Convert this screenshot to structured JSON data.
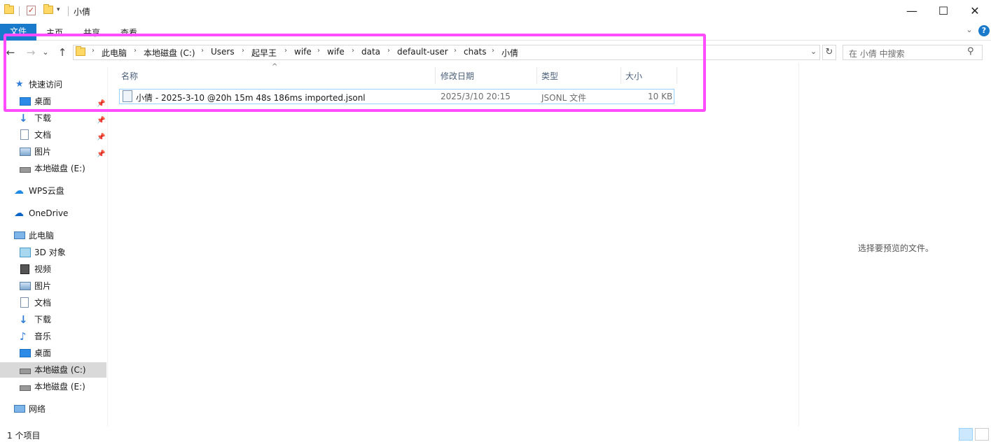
{
  "window": {
    "title": "小倩",
    "minimize": "—",
    "maximize": "☐",
    "close": "✕"
  },
  "ribbon": {
    "tabs": [
      "文件",
      "主页",
      "共享",
      "查看"
    ],
    "expand_icon": "chevron-down-icon",
    "help": "?"
  },
  "nav": {
    "back": "←",
    "forward": "→",
    "recent": "⌄",
    "up": "↑",
    "breadcrumb": [
      "此电脑",
      "本地磁盘 (C:)",
      "Users",
      "起早王",
      "wife",
      "wife",
      "data",
      "default-user",
      "chats",
      "小倩"
    ],
    "refresh": "↻",
    "search_placeholder": "在 小倩 中搜索"
  },
  "sidebar": {
    "quick_access": "快速访问",
    "quick_items": [
      "桌面",
      "下载",
      "文档",
      "图片",
      "本地磁盘 (E:)"
    ],
    "wps": "WPS云盘",
    "onedrive": "OneDrive",
    "this_pc": "此电脑",
    "pc_items": [
      "3D 对象",
      "视频",
      "图片",
      "文档",
      "下载",
      "音乐",
      "桌面",
      "本地磁盘 (C:)",
      "本地磁盘 (E:)"
    ],
    "network": "网络"
  },
  "columns": {
    "name": "名称",
    "modified": "修改日期",
    "type": "类型",
    "size": "大小"
  },
  "files": [
    {
      "name": "小倩 - 2025-3-10 @20h 15m 48s 186ms imported.jsonl",
      "modified": "2025/3/10 20:15",
      "type": "JSONL 文件",
      "size": "10 KB"
    }
  ],
  "preview": {
    "empty_text": "选择要预览的文件。"
  },
  "status": {
    "count": "1 个项目"
  },
  "colors": {
    "accent": "#1979ca",
    "highlight": "#ff4dff",
    "selection": "#cce8ff"
  }
}
